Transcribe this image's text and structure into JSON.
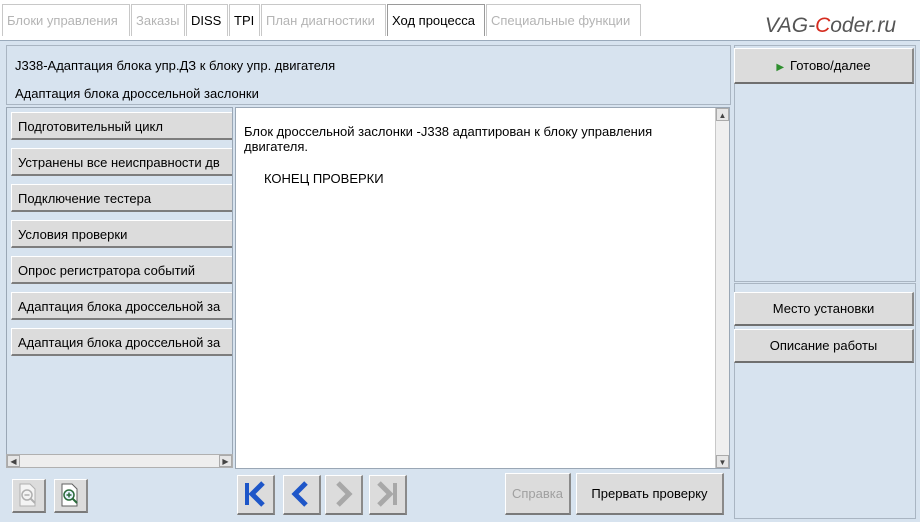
{
  "tabs": [
    {
      "label": "Блоки управления",
      "state": "disabled"
    },
    {
      "label": "Заказы",
      "state": "disabled"
    },
    {
      "label": "DISS",
      "state": "enabled"
    },
    {
      "label": "TPI",
      "state": "enabled"
    },
    {
      "label": "План диагностики",
      "state": "disabled"
    },
    {
      "label": "Ход процесса",
      "state": "active"
    },
    {
      "label": "Специальные функции",
      "state": "disabled"
    }
  ],
  "watermark": {
    "pre": "VAG-",
    "c": "C",
    "post": "oder.ru"
  },
  "header": {
    "line1": "J338-Адаптация блока упр.ДЗ к блоку упр. двигателя",
    "line2": "Адаптация блока дроссельной заслонки"
  },
  "steps": [
    "Подготовительный цикл",
    "Устранены все неисправности дв",
    "Подключение тестера",
    "Условия проверки",
    "Опрос регистратора событий",
    "Адаптация блока дроссельной за",
    "Адаптация блока дроссельной за"
  ],
  "content": {
    "text": "Блок дроссельной заслонки -J338 адаптирован к блоку управления двигателя.",
    "end_text": "КОНЕЦ ПРОВЕРКИ"
  },
  "right": {
    "next_label": "Готово/далее",
    "install_label": "Место установки",
    "description_label": "Описание работы"
  },
  "bottom": {
    "help_label": "Справка",
    "abort_label": "Прервать проверку"
  },
  "colors": {
    "panel_bg": "#d7e3ef",
    "nav_blue": "#1e56c8",
    "play_green": "#2f8f2f",
    "watermark_red": "#d52b1e"
  }
}
